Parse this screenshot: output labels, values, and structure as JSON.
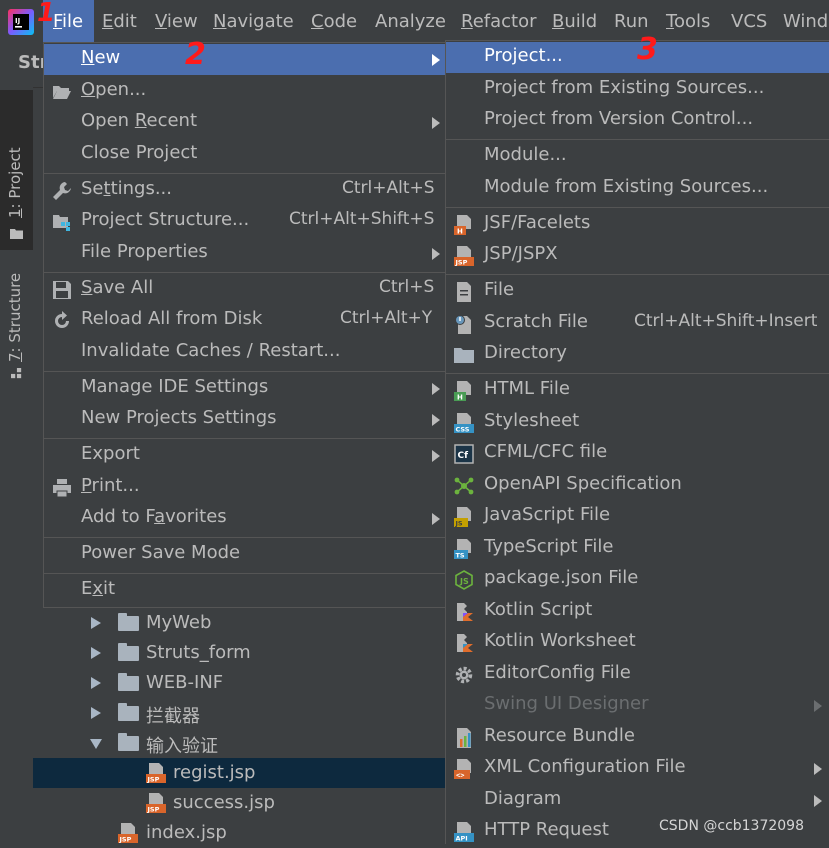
{
  "menubar": {
    "items": [
      {
        "label": "File",
        "mnemonic": "F",
        "rest": "ile"
      },
      {
        "label": "Edit",
        "mnemonic": "E",
        "rest": "dit"
      },
      {
        "label": "View",
        "mnemonic": "V",
        "rest": "iew"
      },
      {
        "label": "Navigate",
        "mnemonic": "N",
        "rest": "avigate"
      },
      {
        "label": "Code",
        "mnemonic": "C",
        "rest": "ode"
      },
      {
        "label": "Analyze",
        "mnemonic": "",
        "rest": "Analyze"
      },
      {
        "label": "Refactor",
        "mnemonic": "R",
        "rest": "efactor"
      },
      {
        "label": "Build",
        "mnemonic": "B",
        "rest": "uild"
      },
      {
        "label": "Run",
        "mnemonic": "",
        "rest": "Run"
      },
      {
        "label": "Tools",
        "mnemonic": "T",
        "rest": "ools"
      },
      {
        "label": "VCS",
        "mnemonic": "",
        "rest": "VCS"
      },
      {
        "label": "Wind",
        "mnemonic": "",
        "rest": "Wind"
      }
    ]
  },
  "annotations": {
    "one": "1",
    "two": "2",
    "three": "3"
  },
  "tool_window_header": "Str",
  "left_strip": {
    "project_tab": {
      "num": "1",
      "label": ": Project"
    },
    "structure_tab": {
      "num": "7",
      "label": ": Structure"
    }
  },
  "file_menu": {
    "items": [
      {
        "label": "New",
        "mn": "N",
        "rest": "ew",
        "shortcut": "",
        "submenu": true
      },
      {
        "label": "Open...",
        "mn": "O",
        "rest": "pen...",
        "shortcut": "",
        "submenu": false
      },
      {
        "label": "Open Recent",
        "pre": "Open ",
        "mn": "R",
        "rest": "ecent",
        "shortcut": "",
        "submenu": true
      },
      {
        "label": "Close Project",
        "shortcut": "",
        "submenu": false
      },
      {
        "label": "Settings...",
        "pre": "Se",
        "mn": "t",
        "rest": "tings...",
        "shortcut": "Ctrl+Alt+S",
        "submenu": false
      },
      {
        "label": "Project Structure...",
        "shortcut": "Ctrl+Alt+Shift+S",
        "submenu": false
      },
      {
        "label": "File Properties",
        "shortcut": "",
        "submenu": true
      },
      {
        "label": "Save All",
        "mn": "S",
        "rest": "ave All",
        "shortcut": "Ctrl+S",
        "submenu": false
      },
      {
        "label": "Reload All from Disk",
        "shortcut": "Ctrl+Alt+Y",
        "submenu": false
      },
      {
        "label": "Invalidate Caches / Restart...",
        "shortcut": "",
        "submenu": false
      },
      {
        "label": "Manage IDE Settings",
        "shortcut": "",
        "submenu": true
      },
      {
        "label": "New Projects Settings",
        "shortcut": "",
        "submenu": true
      },
      {
        "label": "Export",
        "shortcut": "",
        "submenu": true
      },
      {
        "label": "Print...",
        "mn": "P",
        "rest": "rint...",
        "shortcut": "",
        "submenu": false
      },
      {
        "label": "Add to Favorites",
        "pre": "Add to F",
        "mn": "a",
        "rest": "vorites",
        "shortcut": "",
        "submenu": true
      },
      {
        "label": "Power Save Mode",
        "shortcut": "",
        "submenu": false
      },
      {
        "label": "Exit",
        "pre": "E",
        "mn": "x",
        "rest": "it",
        "shortcut": "",
        "submenu": false
      }
    ]
  },
  "new_submenu": {
    "items": [
      {
        "label": "Project...",
        "shortcut": "",
        "icon": "none"
      },
      {
        "label": "Project from Existing Sources...",
        "shortcut": "",
        "icon": "none"
      },
      {
        "label": "Project from Version Control...",
        "shortcut": "",
        "icon": "none"
      },
      {
        "label": "Module...",
        "shortcut": "",
        "icon": "none"
      },
      {
        "label": "Module from Existing Sources...",
        "shortcut": "",
        "icon": "none"
      },
      {
        "label": "JSF/Facelets",
        "shortcut": "",
        "icon": "html-file-icon"
      },
      {
        "label": "JSP/JSPX",
        "shortcut": "",
        "icon": "jsp-file-icon"
      },
      {
        "label": "File",
        "shortcut": "",
        "icon": "file-icon"
      },
      {
        "label": "Scratch File",
        "shortcut": "Ctrl+Alt+Shift+Insert",
        "icon": "scratch-file-icon"
      },
      {
        "label": "Directory",
        "shortcut": "",
        "icon": "folder-icon"
      },
      {
        "label": "HTML File",
        "shortcut": "",
        "icon": "html-file-icon"
      },
      {
        "label": "Stylesheet",
        "shortcut": "",
        "icon": "css-file-icon"
      },
      {
        "label": "CFML/CFC file",
        "shortcut": "",
        "icon": "cfml-file-icon"
      },
      {
        "label": "OpenAPI Specification",
        "shortcut": "",
        "icon": "openapi-icon"
      },
      {
        "label": "JavaScript File",
        "shortcut": "",
        "icon": "js-file-icon"
      },
      {
        "label": "TypeScript File",
        "shortcut": "",
        "icon": "ts-file-icon"
      },
      {
        "label": "package.json File",
        "shortcut": "",
        "icon": "nodejs-icon"
      },
      {
        "label": "Kotlin Script",
        "shortcut": "",
        "icon": "kotlin-script-icon"
      },
      {
        "label": "Kotlin Worksheet",
        "shortcut": "",
        "icon": "kotlin-worksheet-icon"
      },
      {
        "label": "EditorConfig File",
        "shortcut": "",
        "icon": "gear-icon"
      },
      {
        "label": "Swing UI Designer",
        "shortcut": "",
        "icon": "none"
      },
      {
        "label": "Resource Bundle",
        "shortcut": "",
        "icon": "resource-bundle-icon"
      },
      {
        "label": "XML Configuration File",
        "shortcut": "",
        "icon": "xml-file-icon"
      },
      {
        "label": "Diagram",
        "shortcut": "",
        "icon": "none"
      },
      {
        "label": "HTTP Request",
        "shortcut": "",
        "icon": "api-icon"
      }
    ]
  },
  "project_tree": {
    "rows": [
      {
        "label": "MyWeb"
      },
      {
        "label": "Struts_form"
      },
      {
        "label": "WEB-INF"
      },
      {
        "label": "拦截器"
      },
      {
        "label": "输入验证"
      },
      {
        "label": "regist.jsp"
      },
      {
        "label": "success.jsp"
      },
      {
        "label": "index.jsp"
      }
    ]
  },
  "watermark": "CSDN @ccb1372098",
  "colors": {
    "background": "#3c3f41",
    "highlight": "#4b6eaf",
    "selection": "#0d293e",
    "text": "#bbbbbb",
    "disabled_text": "#6b6e70",
    "annotation": "#ff1a1a"
  }
}
